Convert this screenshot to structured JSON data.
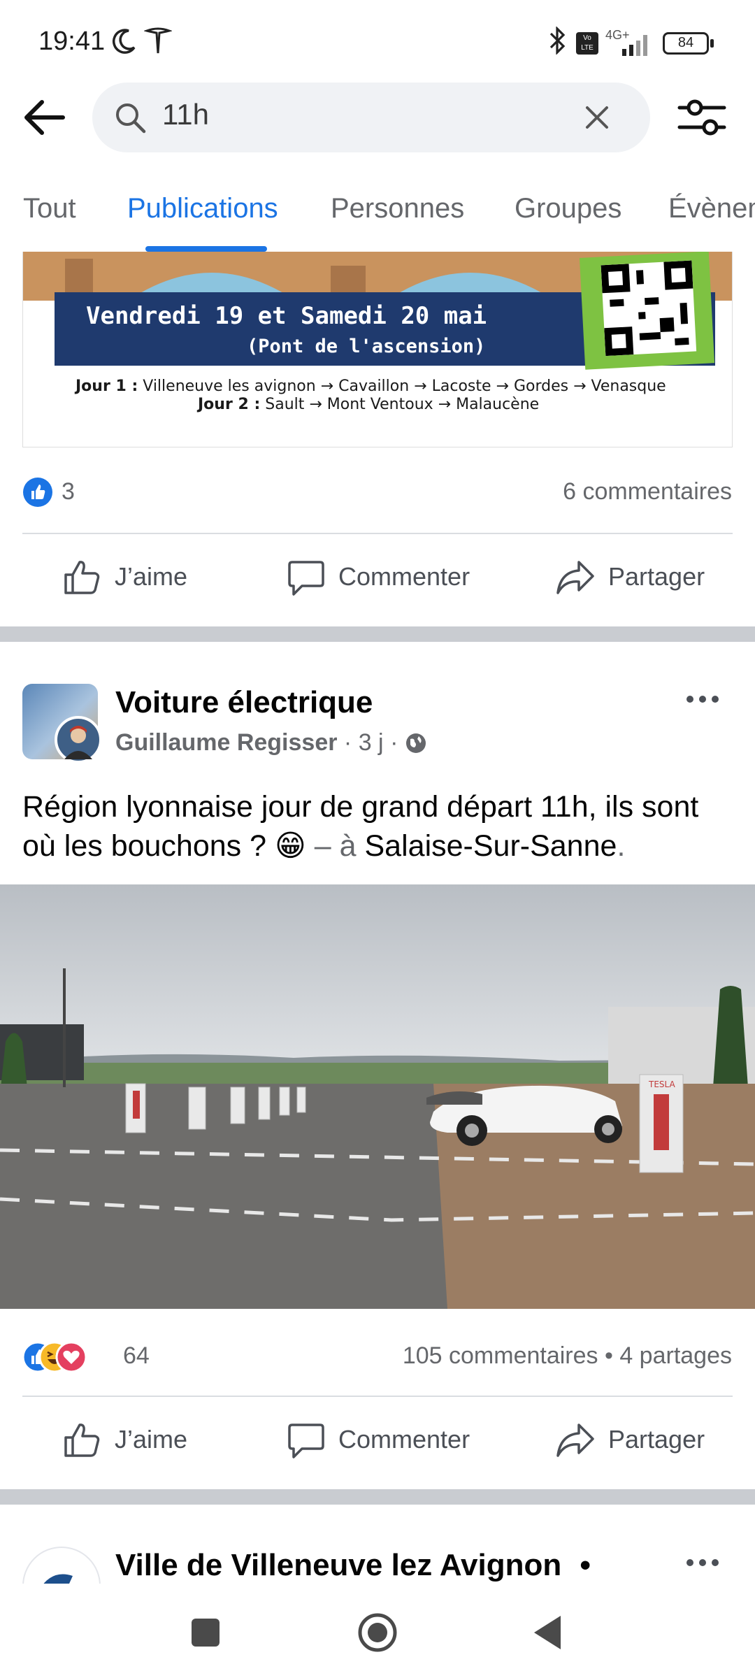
{
  "status_bar": {
    "time": "19:41",
    "battery": "84",
    "network": "4G+",
    "volte": "Vo LTE",
    "icons": [
      "moon-icon",
      "tesla-icon",
      "bluetooth-icon",
      "volte-icon",
      "signal-icon",
      "battery-icon"
    ]
  },
  "search": {
    "query": "11h",
    "icons": [
      "back-arrow-icon",
      "search-icon",
      "clear-icon",
      "filter-icon"
    ]
  },
  "tabs": [
    {
      "label": "Tout",
      "active": false
    },
    {
      "label": "Publications",
      "active": true
    },
    {
      "label": "Personnes",
      "active": false
    },
    {
      "label": "Groupes",
      "active": false
    },
    {
      "label": "Évènements",
      "active": false
    }
  ],
  "post1": {
    "banner": {
      "line1": "Vendredi 19 et Samedi 20 mai",
      "line2": "(Pont de l'ascension)",
      "day1_label": "Jour 1 :",
      "day1_route": "Villeneuve les avignon → Cavaillon → Lacoste → Gordes → Venasque",
      "day2_label": "Jour 2 :",
      "day2_route": "Sault → Mont Ventoux → Malaucène"
    },
    "reactions_count": "3",
    "comments": "6 commentaires",
    "actions": {
      "like": "J’aime",
      "comment": "Commenter",
      "share": "Partager"
    }
  },
  "post2": {
    "group": "Voiture électrique",
    "author": "Guillaume Regisser",
    "time": "3 j",
    "text_main": "Région lyonnaise jour de grand départ 11h, ils sont où les bouchons ? ",
    "emoji": "😁",
    "location_sep": " – à ",
    "location": "Salaise-Sur-Sanne",
    "location_end": ".",
    "reactions_count": "64",
    "comments_shares": "105 commentaires • 4 partages",
    "photo_sign": "TESLA",
    "actions": {
      "like": "J’aime",
      "comment": "Commenter",
      "share": "Partager"
    }
  },
  "post3": {
    "group": "Ville de Villeneuve lez Avignon"
  },
  "colors": {
    "accent": "#1b74e4",
    "text_secondary": "#65676b",
    "separator": "#c9ccd1"
  }
}
